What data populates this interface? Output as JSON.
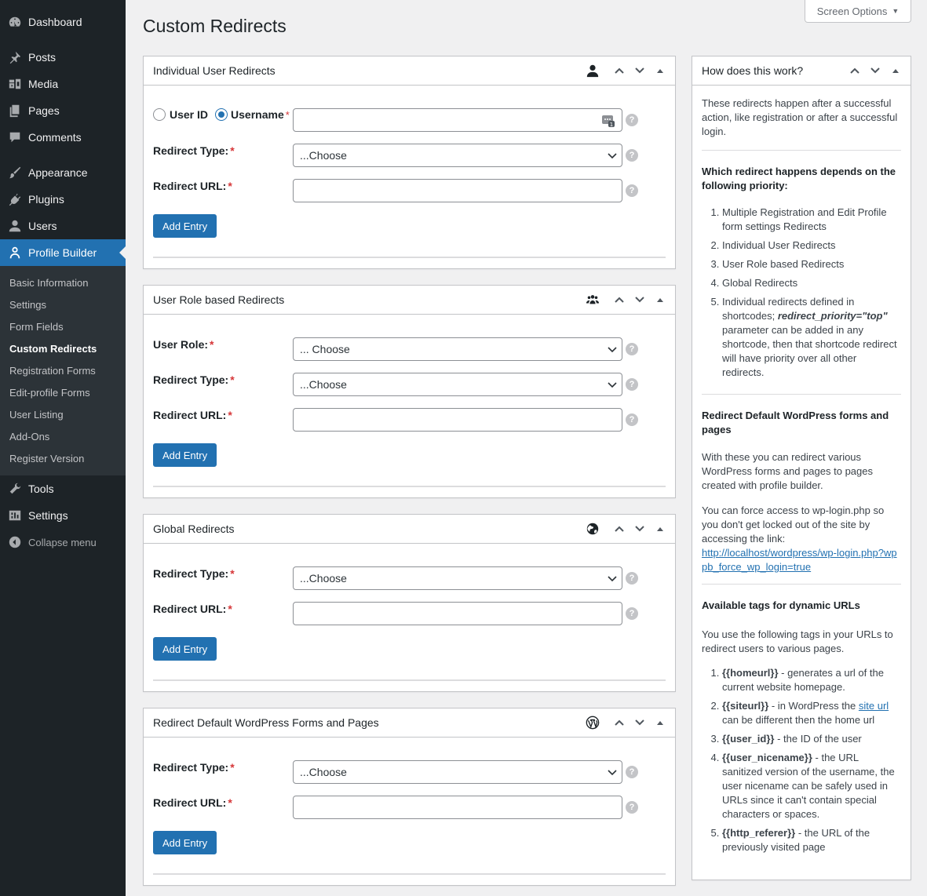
{
  "sidebar": {
    "items": [
      {
        "label": "Dashboard",
        "icon": "dashboard-icon"
      },
      {
        "label": "Posts",
        "icon": "pin-icon"
      },
      {
        "label": "Media",
        "icon": "media-icon"
      },
      {
        "label": "Pages",
        "icon": "pages-icon"
      },
      {
        "label": "Comments",
        "icon": "comment-icon"
      },
      {
        "label": "Appearance",
        "icon": "brush-icon"
      },
      {
        "label": "Plugins",
        "icon": "plugin-icon"
      },
      {
        "label": "Users",
        "icon": "user-icon"
      },
      {
        "label": "Profile Builder",
        "icon": "profile-icon"
      }
    ],
    "submenu": [
      "Basic Information",
      "Settings",
      "Form Fields",
      "Custom Redirects",
      "Registration Forms",
      "Edit-profile Forms",
      "User Listing",
      "Add-Ons",
      "Register Version"
    ],
    "after": [
      {
        "label": "Tools",
        "icon": "wrench-icon"
      },
      {
        "label": "Settings",
        "icon": "settings-icon"
      }
    ],
    "collapse_label": "Collapse menu"
  },
  "screen_options_label": "Screen Options",
  "page_title": "Custom Redirects",
  "boxes": {
    "individual": {
      "title": "Individual User Redirects",
      "radio_user_id": "User ID",
      "radio_username": "Username",
      "redirect_type_label": "Redirect Type:",
      "redirect_type_value": "...Choose",
      "redirect_url_label": "Redirect URL:",
      "button": "Add Entry"
    },
    "role": {
      "title": "User Role based Redirects",
      "user_role_label": "User Role:",
      "user_role_value": "... Choose",
      "redirect_type_label": "Redirect Type:",
      "redirect_type_value": "...Choose",
      "redirect_url_label": "Redirect URL:",
      "button": "Add Entry"
    },
    "global": {
      "title": "Global Redirects",
      "redirect_type_label": "Redirect Type:",
      "redirect_type_value": "...Choose",
      "redirect_url_label": "Redirect URL:",
      "button": "Add Entry"
    },
    "default_wp": {
      "title": "Redirect Default WordPress Forms and Pages",
      "redirect_type_label": "Redirect Type:",
      "redirect_type_value": "...Choose",
      "redirect_url_label": "Redirect URL:",
      "button": "Add Entry"
    }
  },
  "required_mark": "*",
  "help_mark": "?",
  "howbox": {
    "title": "How does this work?",
    "intro": "These redirects happen after a successful action, like registration or after a successful login.",
    "priority_heading": "Which redirect happens depends on the following priority:",
    "priority_list": {
      "1": "Multiple Registration and Edit Profile form settings Redirects",
      "2": "Individual User Redirects",
      "3": "User Role based Redirects",
      "4": "Global Redirects",
      "5a": "Individual redirects defined in shortcodes;",
      "5b": "redirect_priority=\"top\"",
      "5c": "parameter can be added in any shortcode, then that shortcode redirect will have priority over all other redirects."
    },
    "default_heading": "Redirect Default WordPress forms and pages",
    "default_p1": "With these you can redirect various WordPress forms and pages to pages created with profile builder.",
    "default_p2": "You can force access to wp-login.php so you don't get locked out of the site by accessing the link:",
    "default_link": "http://localhost/wordpress/wp-login.php?wppb_force_wp_login=true",
    "tags_heading": "Available tags for dynamic URLs",
    "tags_intro": "You use the following tags in your URLs to redirect users to various pages.",
    "tags": {
      "t1": "{{homeurl}}",
      "d1": " - generates a url of the current website homepage.",
      "t2": "{{siteurl}}",
      "d2a": " - in WordPress the ",
      "d2link": "site url",
      "d2b": " can be different then the home url",
      "t3": "{{user_id}}",
      "d3": " - the ID of the user",
      "t4": "{{user_nicename}}",
      "d4": " - the URL sanitized version of the username, the user nicename can be safely used in URLs since it can't contain special characters or spaces.",
      "t5": "{{http_referer}}",
      "d5": " - the URL of the previously visited page"
    }
  },
  "colors": {
    "sidebar_bg": "#1d2327",
    "accent": "#2271b1",
    "required": "#d63638"
  }
}
